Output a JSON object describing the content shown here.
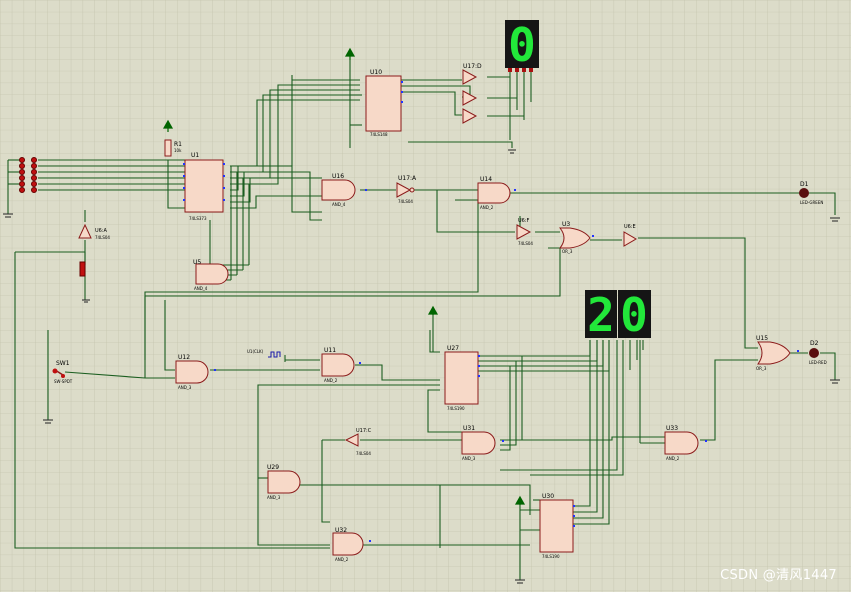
{
  "colors": {
    "background": "#dcdcc9",
    "grid": "#bdbda6",
    "wire": "#1b5e20",
    "component_body": "#f7d9c8",
    "component_outline": "#8b1a1a",
    "segment_on": "#22e83a",
    "display_body": "#151515",
    "pin_dot": "#2233ff",
    "rail": "#006400",
    "led": "#5a0e0e"
  },
  "displays": {
    "top_digit": "0",
    "bottom_tens": "2",
    "bottom_units": "0"
  },
  "components": {
    "r1": {
      "name": "R1",
      "value": "10k"
    },
    "u1": {
      "name": "U1",
      "part": "74LS373"
    },
    "u10": {
      "name": "U10",
      "part": "74LS148"
    },
    "u17d": {
      "name": "U17:D",
      "part": "74LS04"
    },
    "u16": {
      "name": "U16",
      "part": "AND_4"
    },
    "u17a": {
      "name": "U17:A",
      "part": "74LS04"
    },
    "u14": {
      "name": "U14",
      "part": "AND_2"
    },
    "u6f": {
      "name": "U6:F",
      "part": "74LS04"
    },
    "u3": {
      "name": "U3",
      "part": "OR_3"
    },
    "u6e": {
      "name": "U6:E",
      "part": "74LS04"
    },
    "u6a": {
      "name": "U6:A",
      "part": "74LS04"
    },
    "u5": {
      "name": "U5",
      "part": "AND_4"
    },
    "u12": {
      "name": "U12",
      "part": "AND_3"
    },
    "u11": {
      "name": "U11",
      "part": "AND_2"
    },
    "u27": {
      "name": "U27",
      "part": "74LS190"
    },
    "u15": {
      "name": "U15",
      "part": "OR_3"
    },
    "u17c": {
      "name": "U17:C",
      "part": "74LS04"
    },
    "u31": {
      "name": "U31",
      "part": "AND_3"
    },
    "u33": {
      "name": "U33",
      "part": "AND_2"
    },
    "u29": {
      "name": "U29",
      "part": "AND_3"
    },
    "u32": {
      "name": "U32",
      "part": "AND_2"
    },
    "u30": {
      "name": "U30",
      "part": "74LS190"
    },
    "sw1": {
      "name": "SW1",
      "part": "SW-SPDT"
    },
    "d1": {
      "name": "D1",
      "part": "LED-GREEN"
    },
    "d2": {
      "name": "D2",
      "part": "LED-RED"
    },
    "clock": {
      "name": "U1(CLK)"
    }
  },
  "watermark": "CSDN @清风1447"
}
